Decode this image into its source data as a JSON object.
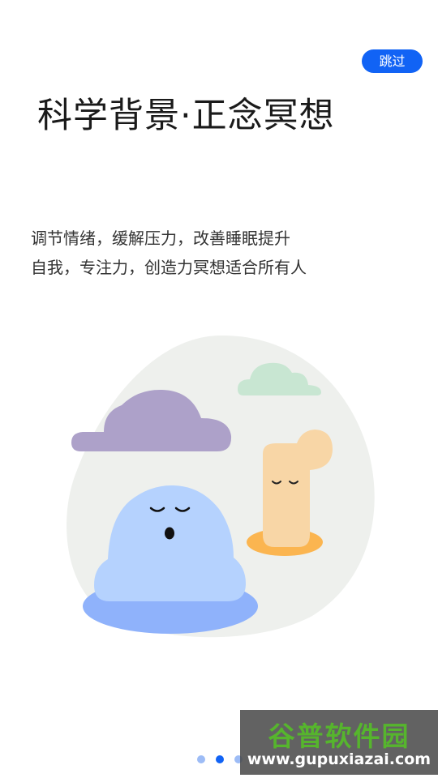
{
  "header": {
    "skip_label": "跳过"
  },
  "main": {
    "title": "科学背景·正念冥想",
    "description_lines": [
      "调节情绪，缓解压力，改善睡眠提升",
      "自我，专注力，创造力冥想适合所有人"
    ]
  },
  "pager": {
    "count": 3,
    "active_index": 1
  },
  "watermark": {
    "title": "谷普软件园",
    "url": "www.gupuxiazai.com"
  },
  "colors": {
    "accent": "#1163f5",
    "cloud_purple": "#ada1c9",
    "cloud_green": "#c8e6d2",
    "blob_blue": "#b5d2fe",
    "puddle_blue": "#8fb2fb",
    "pillar_peach": "#f8d6a6",
    "puddle_orange": "#fbb550",
    "backdrop": "#eef0ed"
  }
}
